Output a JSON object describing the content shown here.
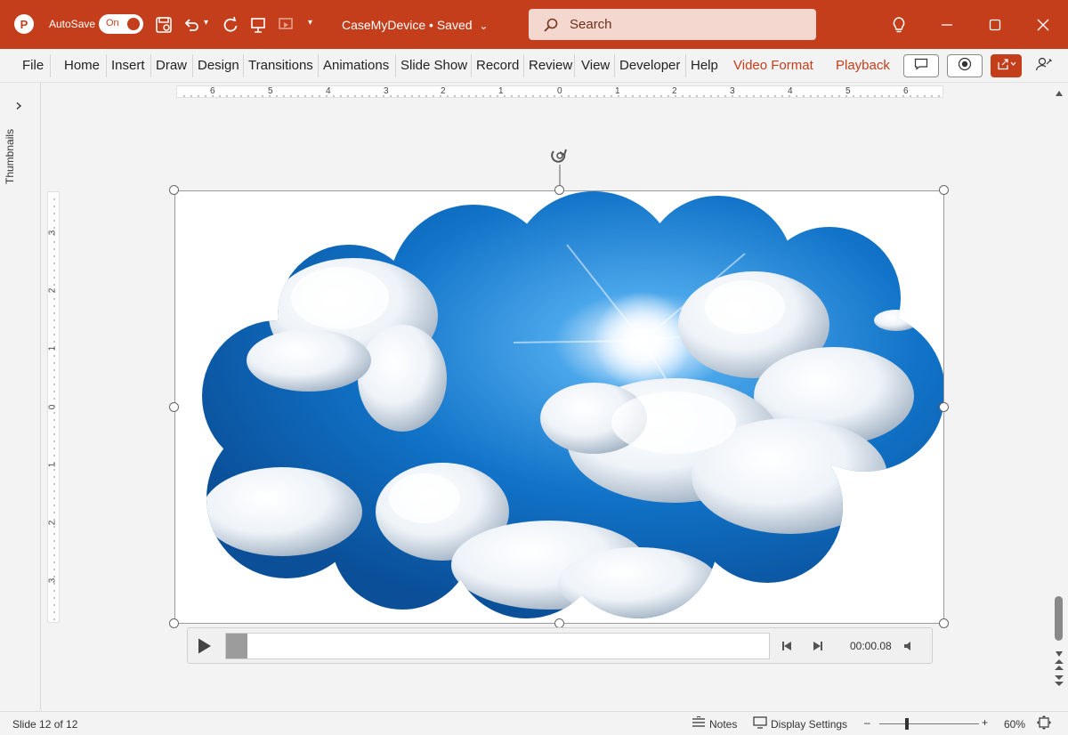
{
  "titlebar": {
    "app_logo": "P",
    "autosave_label": "AutoSave",
    "autosave_state": "On",
    "doc_title": "CaseMyDevice • Saved",
    "search_placeholder": "Search"
  },
  "ribbon": {
    "tabs": [
      "File",
      "Home",
      "Insert",
      "Draw",
      "Design",
      "Transitions",
      "Animations",
      "Slide Show",
      "Record",
      "Review",
      "View",
      "Developer",
      "Help",
      "Video Format",
      "Playback"
    ]
  },
  "thumbnails": {
    "label": "Thumbnails"
  },
  "ruler": {
    "horizontal": [
      "6",
      "5",
      "4",
      "3",
      "2",
      "1",
      "0",
      "1",
      "2",
      "3",
      "4",
      "5",
      "6"
    ],
    "vertical": [
      "3",
      "2",
      "1",
      "0",
      "1",
      "2",
      "3"
    ]
  },
  "media": {
    "time": "00:00.08",
    "progress_fraction": 0.01
  },
  "status": {
    "slide_info": "Slide 12 of 12",
    "notes_label": "Notes",
    "display_settings_label": "Display Settings",
    "zoom_minus": "–",
    "zoom_plus": "+",
    "zoom_level": "60%"
  },
  "colors": {
    "accent": "#c43e1c",
    "sky_dark": "#0b5fb0",
    "sky_light": "#3b9be0"
  },
  "icons": [
    "powerpoint-logo-icon",
    "save-icon",
    "undo-icon",
    "redo-icon",
    "present-icon",
    "lightbulb-icon",
    "comment-icon",
    "record-icon",
    "share-icon",
    "coauthor-icon",
    "play-icon",
    "skip-back-icon",
    "skip-forward-icon",
    "volume-icon",
    "fit-slide-icon"
  ]
}
